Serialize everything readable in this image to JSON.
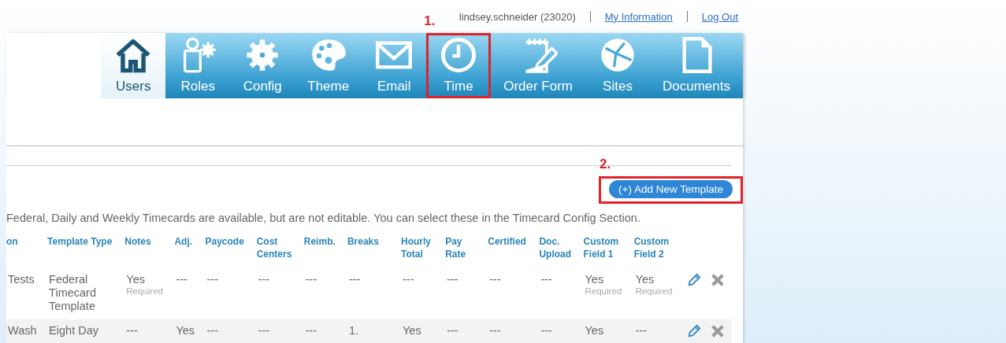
{
  "account_bar": {
    "user": "lindsey.schneider (23020)",
    "links": [
      "My Information",
      "Log Out"
    ]
  },
  "nav_tabs": [
    {
      "label": "Users",
      "kind": "house",
      "selected": true
    },
    {
      "label": "Roles",
      "kind": "roles",
      "selected": false
    },
    {
      "label": "Config",
      "kind": "gear",
      "selected": false
    },
    {
      "label": "Theme",
      "kind": "palette",
      "selected": false
    },
    {
      "label": "Email",
      "kind": "envelope",
      "selected": false
    },
    {
      "label": "Time",
      "kind": "clock",
      "selected": false,
      "callout": "1."
    },
    {
      "label": "Order Form",
      "kind": "notepad",
      "selected": false
    },
    {
      "label": "Sites",
      "kind": "globe",
      "selected": false
    },
    {
      "label": "Documents",
      "kind": "document",
      "selected": false
    }
  ],
  "add_button": {
    "label": "(+) Add New Template",
    "callout": "2."
  },
  "description": "Federal, Daily and Weekly Timecards are available, but are not editable. You can select these in the Timecard Config Section.",
  "table": {
    "columns": [
      "on",
      "Template Type",
      "Notes",
      "Adj.",
      "Paycode",
      "Cost Centers",
      "Reimb.",
      "Breaks",
      "Hourly Total",
      "Pay Rate",
      "Certified",
      "Doc. Upload",
      "Custom Field 1",
      "Custom Field 2"
    ],
    "rows": [
      {
        "cells": [
          {
            "text": "Tests"
          },
          {
            "text": "Federal Timecard Template"
          },
          {
            "text": "Yes",
            "note": "Required"
          },
          {
            "text": "---"
          },
          {
            "text": "---"
          },
          {
            "text": "---"
          },
          {
            "text": "---"
          },
          {
            "text": "---"
          },
          {
            "text": "---"
          },
          {
            "text": "---"
          },
          {
            "text": "---"
          },
          {
            "text": "---"
          },
          {
            "text": "Yes",
            "note": "Required"
          },
          {
            "text": "Yes",
            "note": "Required"
          }
        ]
      },
      {
        "cells": [
          {
            "text": "Wash"
          },
          {
            "text": "Eight Day"
          },
          {
            "text": "---"
          },
          {
            "text": "Yes"
          },
          {
            "text": "---"
          },
          {
            "text": "---"
          },
          {
            "text": "---"
          },
          {
            "text": "1."
          },
          {
            "text": "Yes"
          },
          {
            "text": "---"
          },
          {
            "text": "---"
          },
          {
            "text": "---"
          },
          {
            "text": "Yes"
          },
          {
            "text": "---"
          }
        ]
      }
    ]
  }
}
